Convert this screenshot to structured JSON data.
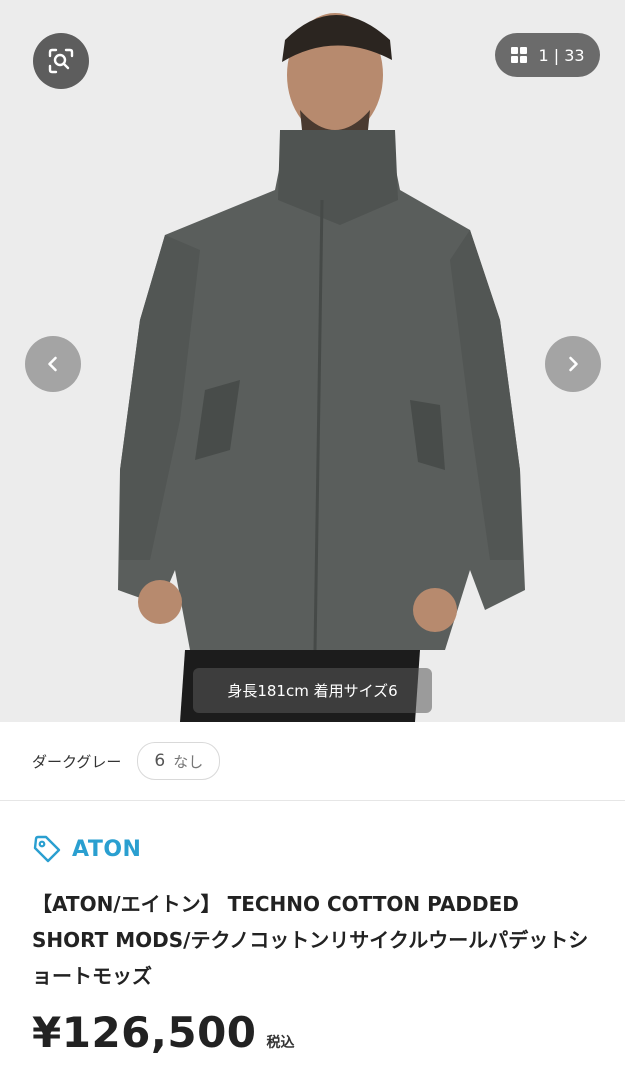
{
  "gallery": {
    "counter_current": "1",
    "counter_separator": "|",
    "counter_total": "33",
    "caption": "身長181cm 着用サイズ6",
    "icons": {
      "lens": "search-lens-icon",
      "grid": "grid-icon",
      "prev": "chevron-left-icon",
      "next": "chevron-right-icon"
    }
  },
  "variant": {
    "color_label": "ダークグレー",
    "size": "6",
    "stock": "なし"
  },
  "brand": {
    "name": "ATON",
    "icon": "tag-icon",
    "color": "#2a9fd0"
  },
  "product": {
    "title": "【ATON/エイトン】 TECHNO COTTON PADDED SHORT MODS/テクノコットンリサイクルウールパデットショートモッズ",
    "price": "¥126,500",
    "tax_label": "税込"
  }
}
